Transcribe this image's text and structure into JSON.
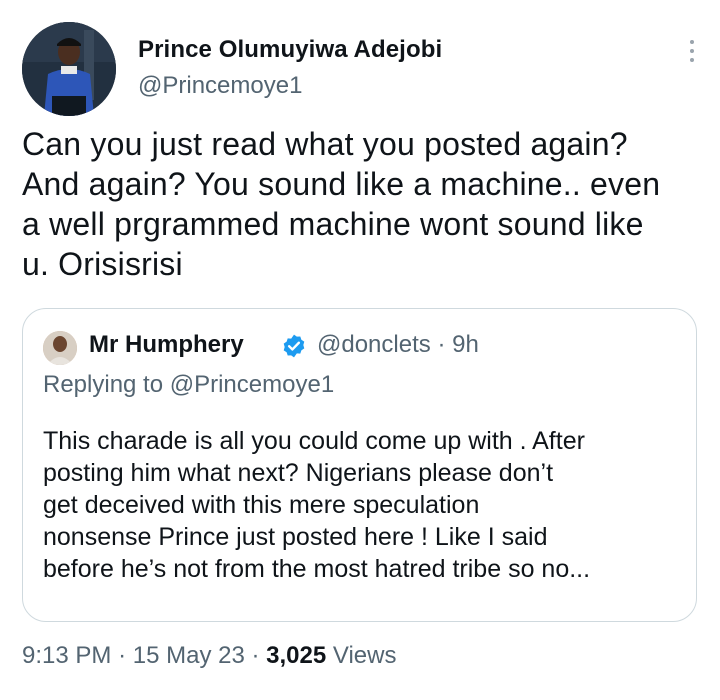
{
  "author": {
    "name": "Prince Olumuyiwa Adejobi",
    "handle": "@Princemoye1"
  },
  "tweet": {
    "lines": [
      "Can you just read what you posted again?",
      "And again? You sound like a machine.. even",
      "a well prgrammed machine wont sound like",
      "u. Orisisrisi"
    ]
  },
  "quoted": {
    "name": "Mr Humphery",
    "handle": "@donclets",
    "time": "9h",
    "replying": "Replying to @Princemoye1",
    "lines": [
      "This charade is all you could come up with . After",
      "posting him what next? Nigerians please don’t",
      "get deceived with this mere speculation",
      "nonsense Prince just posted here ! Like I said",
      "before he’s not from the most hatred tribe so no..."
    ]
  },
  "footer": {
    "time": "9:13 PM",
    "date": "15 May 23",
    "views_count": "3,025",
    "views_label": "Views"
  },
  "colors": {
    "text": "#0f1419",
    "secondary": "#536471",
    "border": "#cfd9de",
    "verified": "#1d9bf0"
  }
}
